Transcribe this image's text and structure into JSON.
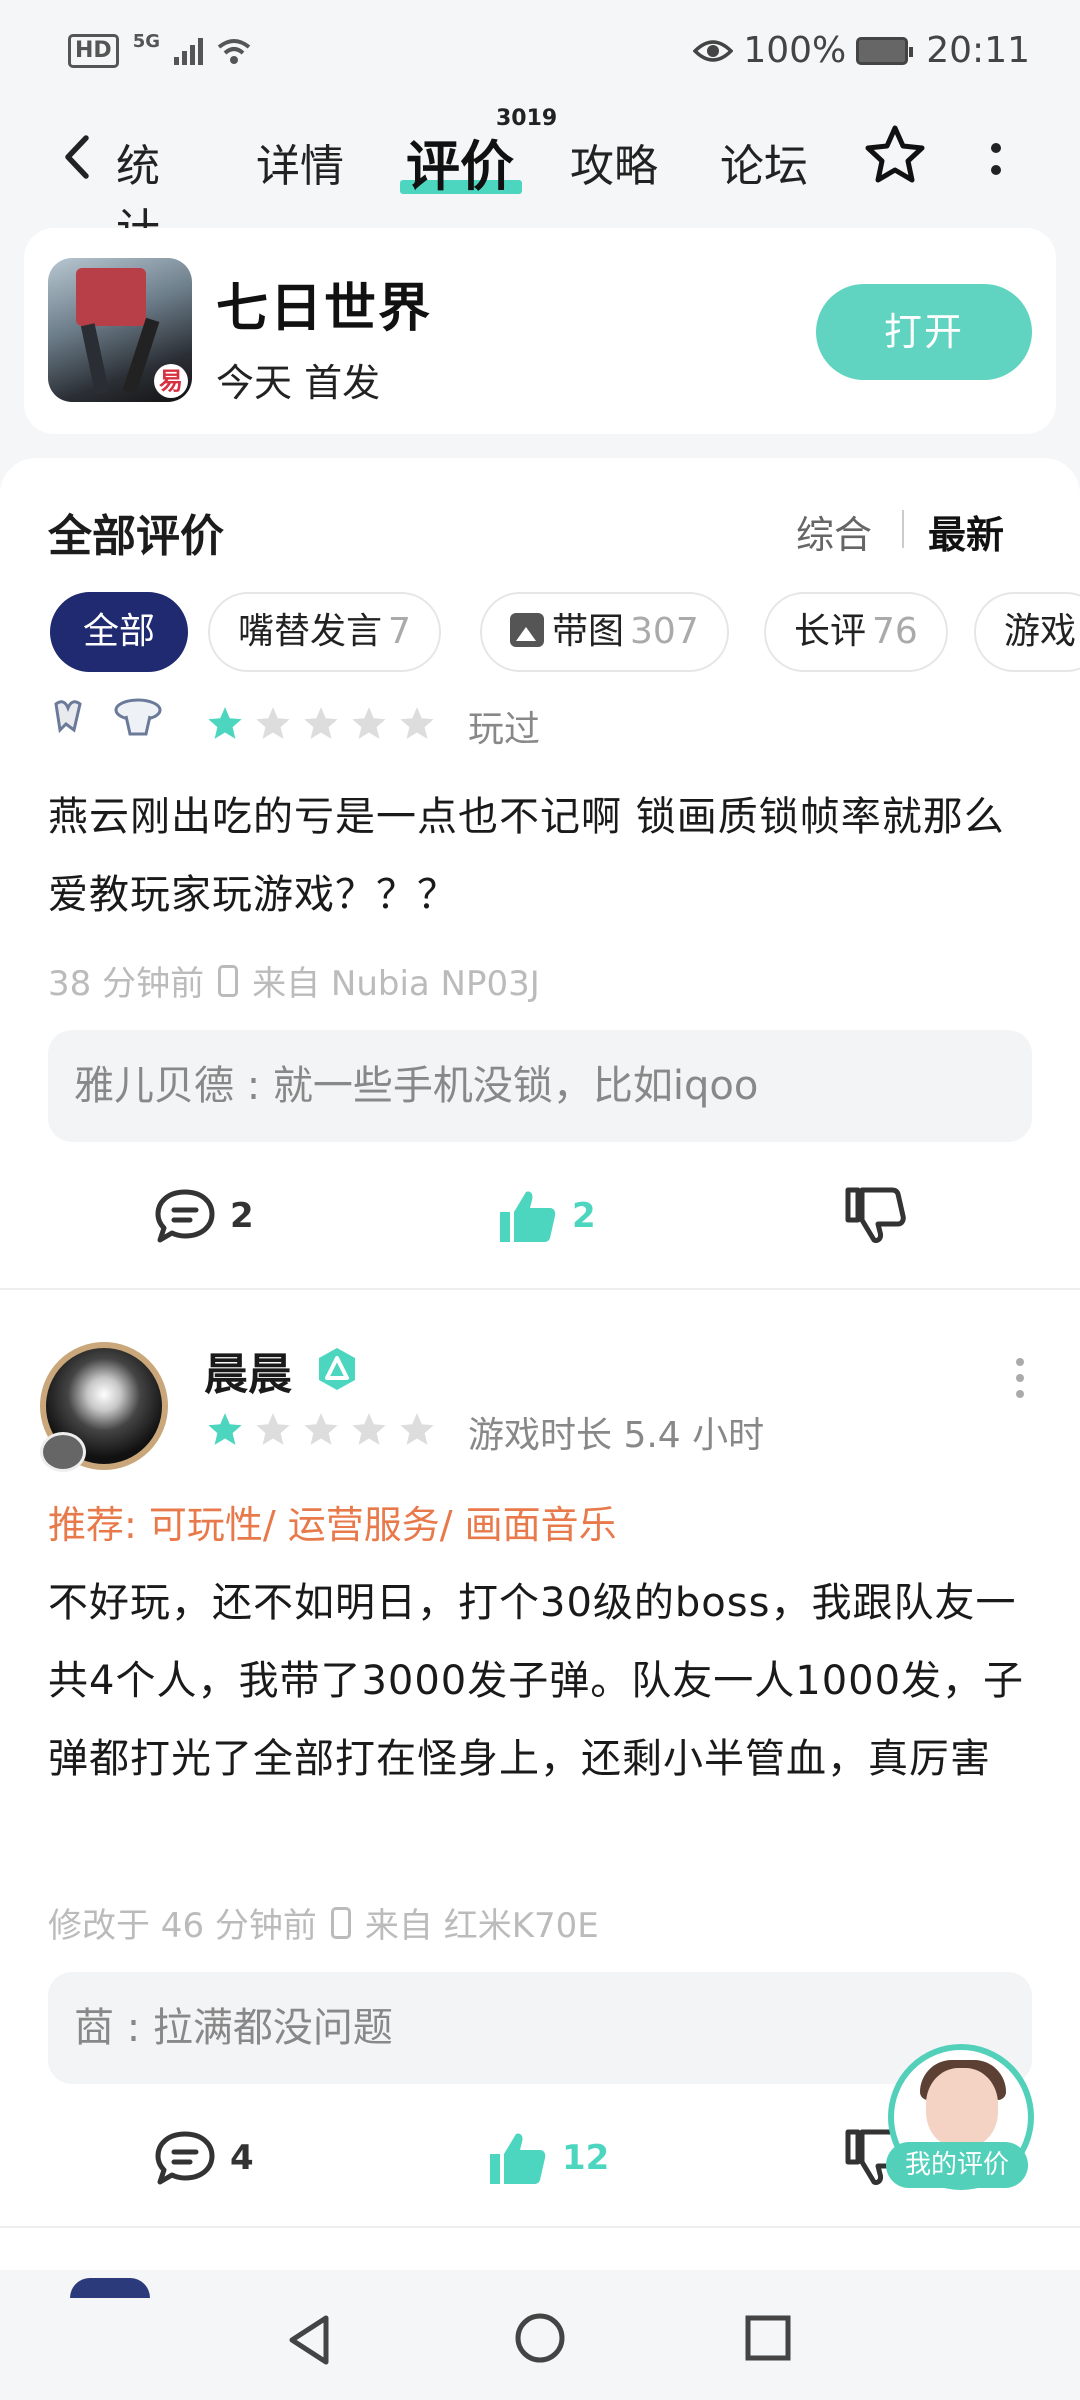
{
  "status_bar": {
    "hd": "HD",
    "network": "5G",
    "battery_percent": "100%",
    "time": "20:11"
  },
  "nav": {
    "back_partial_label": "统计",
    "tabs": [
      {
        "label": "详情"
      },
      {
        "label": "评价",
        "active": true,
        "badge": "3019"
      },
      {
        "label": "攻略"
      },
      {
        "label": "论坛"
      }
    ]
  },
  "game": {
    "name": "七日世界",
    "subtitle": "今天 首发",
    "open_label": "打开"
  },
  "reviews_header": {
    "title": "全部评价",
    "sort_options": [
      "综合",
      "最新"
    ],
    "selected_sort": "最新"
  },
  "filters": [
    {
      "label": "全部",
      "count": "",
      "active": true
    },
    {
      "label": "嘴替发言",
      "count": "7"
    },
    {
      "label": "带图",
      "count": "307"
    },
    {
      "label": "长评",
      "count": "76"
    },
    {
      "label": "游戏",
      "count": ""
    }
  ],
  "reviews": [
    {
      "rating": 1,
      "played_label": "玩过",
      "content": "燕云刚出吃的亏是一点也不记啊 锁画质锁帧率就那么爱教玩家玩游戏？？？",
      "time": "38 分钟前",
      "device": "来自 Nubia NP03J",
      "reply": "雅儿贝德 : 就一些手机没锁，比如iqoo",
      "comments": "2",
      "likes": "2"
    },
    {
      "username": "晨晨",
      "rating": 1,
      "play_time": "游戏时长 5.4 小时",
      "recommend": "推荐: 可玩性/ 运营服务/ 画面音乐",
      "content": "不好玩，还不如明日，打个30级的boss，我跟队友一共4个人，我带了3000发子弹。队友一人1000发，子弹都打光了全部打在怪身上，还剩小半管血，真厉害",
      "time": "修改于 46 分钟前",
      "device": "来自 红米K70E",
      "reply": "莔 : 拉满都没问题",
      "comments": "4",
      "likes": "12"
    }
  ],
  "fab": {
    "label": "我的评价"
  },
  "colors": {
    "accent": "#60d4c0",
    "active_chip": "#1f2a70",
    "recommend": "#e8794a",
    "star_filled": "#4cd6bf",
    "star_empty": "#dddddd"
  }
}
